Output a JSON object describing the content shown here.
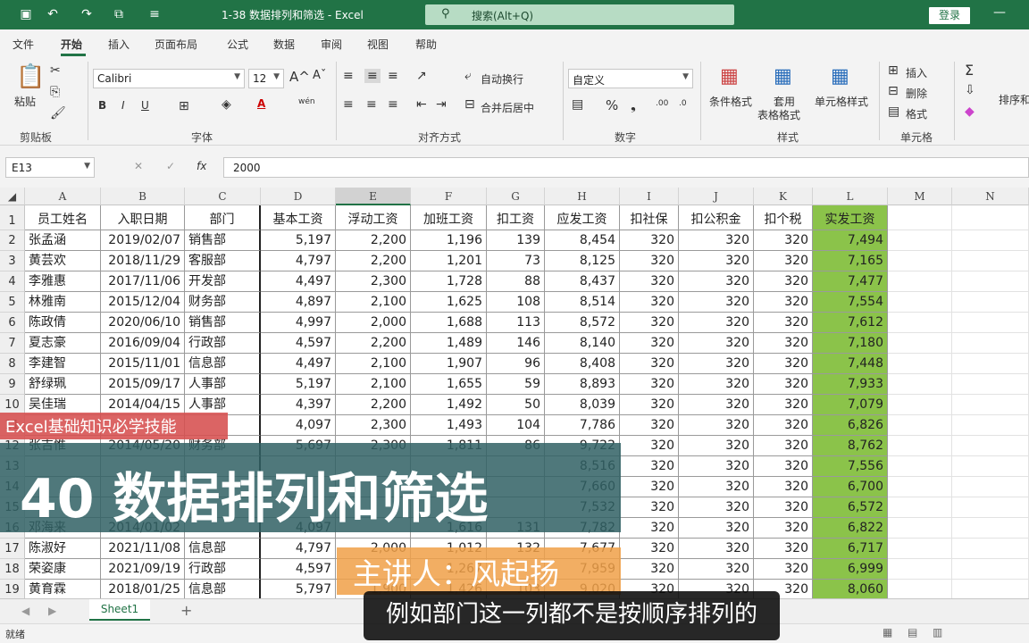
{
  "titlebar": {
    "doc_title": "1-38 数据排列和筛选  -  Excel",
    "search_placeholder": "搜索(Alt+Q)",
    "login_label": "登录"
  },
  "menu": [
    "文件",
    "开始",
    "插入",
    "页面布局",
    "公式",
    "数据",
    "审阅",
    "视图",
    "帮助"
  ],
  "ribbon": {
    "paste_label": "粘贴",
    "clipboard_group": "剪贴板",
    "font_name": "Calibri",
    "font_size": "12",
    "font_group": "字体",
    "wrap_text": "自动换行",
    "merge_center": "合并后居中",
    "align_group": "对齐方式",
    "number_format": "自定义",
    "number_group": "数字",
    "cond_format": "条件格式",
    "table_format_1": "套用",
    "table_format_2": "表格格式",
    "cell_style": "单元格样式",
    "style_group": "样式",
    "insert_label": "插入",
    "delete_label": "删除",
    "format_label": "格式",
    "cells_group": "单元格",
    "sort_filter": "排序和"
  },
  "formula": {
    "name_box": "E13",
    "fx": "fx",
    "value": "2000"
  },
  "columns": [
    "A",
    "B",
    "C",
    "D",
    "E",
    "F",
    "G",
    "H",
    "I",
    "J",
    "K",
    "L",
    "M",
    "N"
  ],
  "headers": [
    "员工姓名",
    "入职日期",
    "部门",
    "基本工资",
    "浮动工资",
    "加班工资",
    "扣工资",
    "应发工资",
    "扣社保",
    "扣公积金",
    "扣个税",
    "实发工资"
  ],
  "rows": [
    [
      "张孟涵",
      "2019/02/07",
      "销售部",
      "5,197",
      "2,200",
      "1,196",
      "139",
      "8,454",
      "320",
      "320",
      "320",
      "7,494"
    ],
    [
      "黄芸欢",
      "2018/11/29",
      "客服部",
      "4,797",
      "2,200",
      "1,201",
      "73",
      "8,125",
      "320",
      "320",
      "320",
      "7,165"
    ],
    [
      "李雅惠",
      "2017/11/06",
      "开发部",
      "4,497",
      "2,300",
      "1,728",
      "88",
      "8,437",
      "320",
      "320",
      "320",
      "7,477"
    ],
    [
      "林雅南",
      "2015/12/04",
      "财务部",
      "4,897",
      "2,100",
      "1,625",
      "108",
      "8,514",
      "320",
      "320",
      "320",
      "7,554"
    ],
    [
      "陈政倩",
      "2020/06/10",
      "销售部",
      "4,997",
      "2,000",
      "1,688",
      "113",
      "8,572",
      "320",
      "320",
      "320",
      "7,612"
    ],
    [
      "夏志豪",
      "2016/09/04",
      "行政部",
      "4,597",
      "2,200",
      "1,489",
      "146",
      "8,140",
      "320",
      "320",
      "320",
      "7,180"
    ],
    [
      "李建智",
      "2015/11/01",
      "信息部",
      "4,497",
      "2,100",
      "1,907",
      "96",
      "8,408",
      "320",
      "320",
      "320",
      "7,448"
    ],
    [
      "舒绿珮",
      "2015/09/17",
      "人事部",
      "5,197",
      "2,100",
      "1,655",
      "59",
      "8,893",
      "320",
      "320",
      "320",
      "7,933"
    ],
    [
      "吴佳瑞",
      "2014/04/15",
      "人事部",
      "4,397",
      "2,200",
      "1,492",
      "50",
      "8,039",
      "320",
      "320",
      "320",
      "7,079"
    ],
    [
      "",
      "",
      "",
      "4,097",
      "2,300",
      "1,493",
      "104",
      "7,786",
      "320",
      "320",
      "320",
      "6,826"
    ],
    [
      "张吉惟",
      "2014/05/20",
      "财务部",
      "5,697",
      "2,300",
      "1,811",
      "86",
      "9,722",
      "320",
      "320",
      "320",
      "8,762"
    ],
    [
      "",
      "",
      "",
      "",
      "",
      "",
      "",
      "8,516",
      "320",
      "320",
      "320",
      "7,556"
    ],
    [
      "",
      "",
      "",
      "",
      "",
      "",
      "",
      "7,660",
      "320",
      "320",
      "320",
      "6,700"
    ],
    [
      "",
      "",
      "",
      "",
      "",
      "",
      "",
      "7,532",
      "320",
      "320",
      "320",
      "6,572"
    ],
    [
      "邓海来",
      "2014/01/02",
      "",
      "4,097",
      "",
      "1,616",
      "131",
      "7,782",
      "320",
      "320",
      "320",
      "6,822"
    ],
    [
      "陈淑好",
      "2021/11/08",
      "信息部",
      "4,797",
      "2,000",
      "1,012",
      "132",
      "7,677",
      "320",
      "320",
      "320",
      "6,717"
    ],
    [
      "荣姿康",
      "2021/09/19",
      "行政部",
      "4,597",
      "",
      "1,267",
      "",
      "7,959",
      "320",
      "320",
      "320",
      "6,999"
    ],
    [
      "黄育霖",
      "2018/01/25",
      "信息部",
      "5,797",
      "1,900",
      "1,426",
      "103",
      "9,020",
      "320",
      "320",
      "320",
      "8,060"
    ]
  ],
  "overlay": {
    "series_tag": "Excel基础知识必学技能",
    "lesson_title": "40 数据排列和筛选",
    "speaker": "主讲人：风起扬",
    "subtitle": "例如部门这一列都不是按顺序排列的"
  },
  "sheet": {
    "tab": "Sheet1",
    "add": "+"
  },
  "status": {
    "ready": "就绪"
  },
  "colors": {
    "accent": "#217346",
    "highlight": "#8bc34a"
  }
}
